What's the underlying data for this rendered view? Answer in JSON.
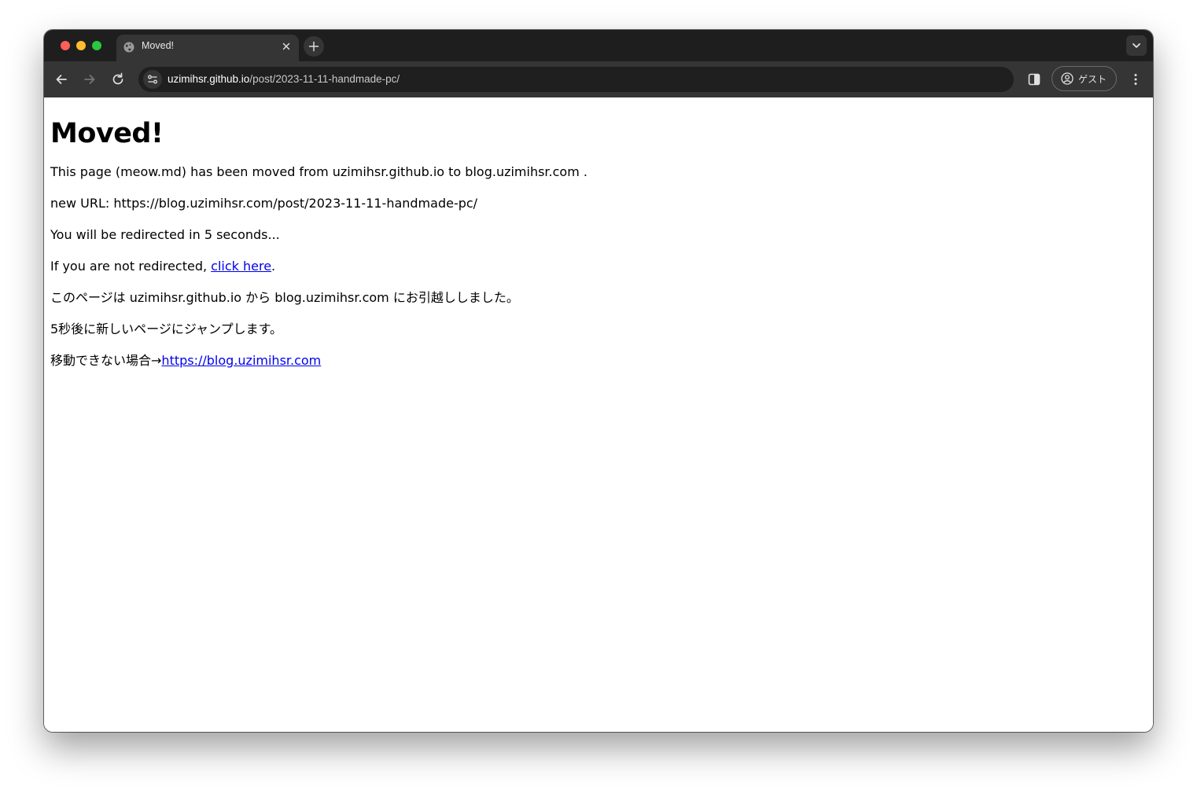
{
  "tab": {
    "title": "Moved!",
    "favicon": "globe-icon"
  },
  "toolbar": {
    "url_host": "uzimihsr.github.io",
    "url_path": "/post/2023-11-11-handmade-pc/",
    "profile_label": "ゲスト"
  },
  "page": {
    "heading": "Moved!",
    "line1": "This page (meow.md) has been moved from uzimihsr.github.io to blog.uzimihsr.com .",
    "line2": "new URL: https://blog.uzimihsr.com/post/2023-11-11-handmade-pc/",
    "line3": "You will be redirected in 5 seconds...",
    "line4_prefix": "If you are not redirected, ",
    "line4_link": "click here",
    "line4_suffix": ".",
    "line5": "このページは uzimihsr.github.io から blog.uzimihsr.com にお引越ししました。",
    "line6": "5秒後に新しいページにジャンプします。",
    "line7_prefix": "移動できない場合→",
    "line7_link": "https://blog.uzimihsr.com"
  },
  "colors": {
    "link": "#0000ee",
    "tabstrip": "#1e1e1e",
    "toolbar": "#353535"
  }
}
